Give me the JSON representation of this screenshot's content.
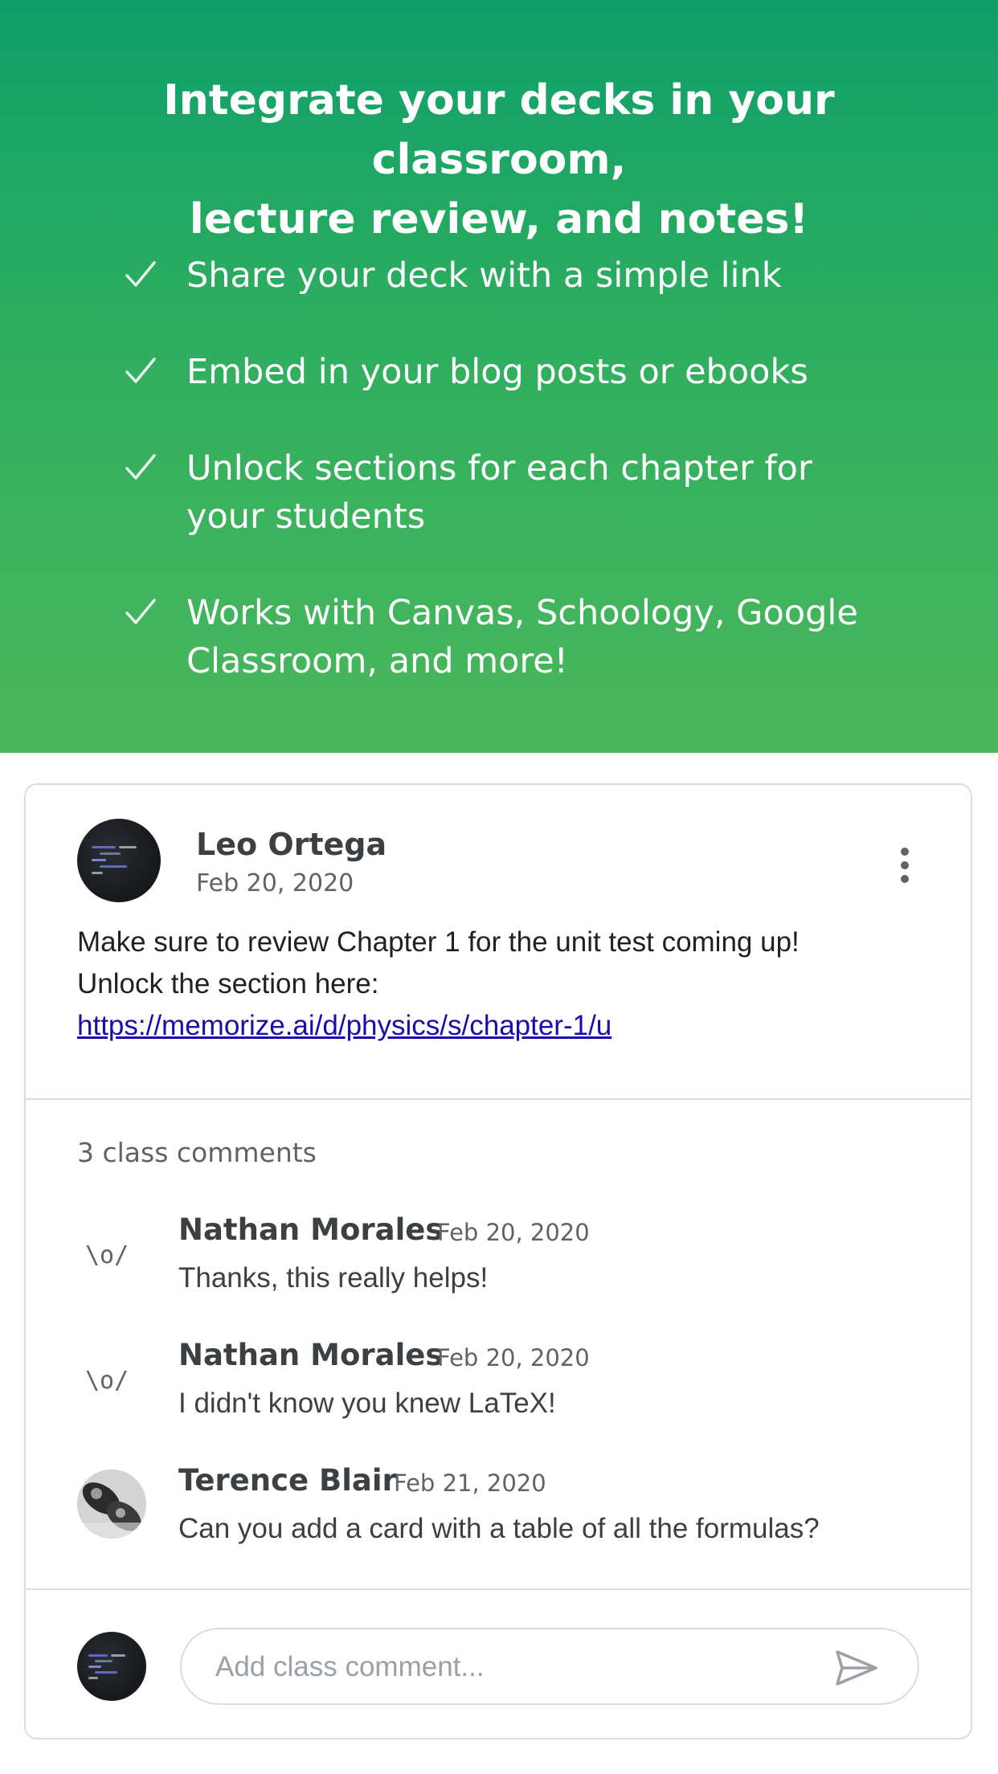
{
  "hero": {
    "title_line1": "Integrate your decks in your classroom,",
    "title_line2": "lecture review, and notes!",
    "features": [
      {
        "line1": "Share your deck with a simple link",
        "line2": ""
      },
      {
        "line1": "Embed in your blog posts or ebooks",
        "line2": ""
      },
      {
        "line1": "Unlock sections for each chapter for",
        "line2": "your students"
      },
      {
        "line1": "Works with Canvas, Schoology, Google",
        "line2": "Classroom, and more!"
      }
    ],
    "check_icon": "check-icon"
  },
  "post": {
    "author": "Leo Ortega",
    "date": "Feb 20, 2020",
    "text_line1": "Make sure to review Chapter 1 for the unit test coming up!",
    "text_line2": "Unlock the section here:",
    "link": "https://memorize.ai/d/physics/s/chapter-1/u"
  },
  "comments": {
    "count_label": "3 class comments",
    "items": [
      {
        "name": "Nathan Morales",
        "date": "Feb 20, 2020",
        "text": "Thanks, this really helps!",
        "avatar_text": "\\o/"
      },
      {
        "name": "Nathan Morales",
        "date": "Feb 20, 2020",
        "text": "I didn't know you knew LaTeX!",
        "avatar_text": "\\o/"
      },
      {
        "name": "Terence Blair",
        "date": "Feb 21, 2020",
        "text": "Can you add a card with a table of all the formulas?",
        "avatar_text": ""
      }
    ]
  },
  "composer": {
    "placeholder": "Add class comment...",
    "send_icon": "send-icon"
  },
  "colors": {
    "hero_top": "#0e9f6a",
    "hero_bottom": "#4bb75c",
    "link": "#1a0dab"
  }
}
